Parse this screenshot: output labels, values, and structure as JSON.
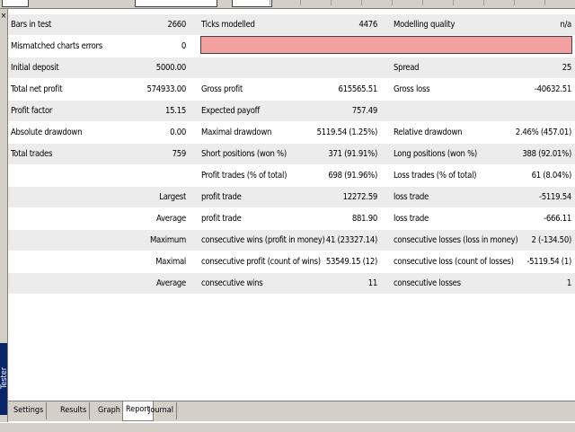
{
  "window": {
    "panel_label": "Tester"
  },
  "report": {
    "rows": [
      {
        "style": "gray",
        "c1": "Bars in test",
        "c2": "2660",
        "c3": "Ticks modelled",
        "c4": "4476",
        "c5": "Modelling quality",
        "c6": "n/a"
      },
      {
        "style": "white",
        "c1": "Mismatched charts errors",
        "c2": "0",
        "c3": "",
        "c4": "",
        "c5": "",
        "c6": ""
      },
      {
        "style": "gray",
        "c1": "Initial deposit",
        "c2": "5000.00",
        "c3": "",
        "c4": "",
        "c5": "Spread",
        "c6": "25"
      },
      {
        "style": "white",
        "c1": "Total net profit",
        "c2": "574933.00",
        "c3": "Gross profit",
        "c4": "615565.51",
        "c5": "Gross loss",
        "c6": "-40632.51"
      },
      {
        "style": "gray",
        "c1": "Profit factor",
        "c2": "15.15",
        "c3": "Expected payoff",
        "c4": "757.49",
        "c5": "",
        "c6": ""
      },
      {
        "style": "white",
        "c1": "Absolute drawdown",
        "c2": "0.00",
        "c3": "Maximal drawdown",
        "c4": "5119.54 (1.25%)",
        "c5": "Relative drawdown",
        "c6": "2.46% (457.01)"
      },
      {
        "style": "gray",
        "c1": "Total trades",
        "c2": "759",
        "c3": "Short positions (won %)",
        "c4": "371 (91.91%)",
        "c5": "Long positions (won %)",
        "c6": "388 (92.01%)"
      },
      {
        "style": "white",
        "c1": "",
        "c2": "",
        "c3": "Profit trades (% of total)",
        "c4": "698 (91.96%)",
        "c5": "Loss trades (% of total)",
        "c6": "61 (8.04%)"
      },
      {
        "style": "gray",
        "c1": "",
        "c2": "Largest",
        "c3": "profit trade",
        "c4": "12272.59",
        "c5": "loss trade",
        "c6": "-5119.54"
      },
      {
        "style": "white",
        "c1": "",
        "c2": "Average",
        "c3": "profit trade",
        "c4": "881.90",
        "c5": "loss trade",
        "c6": "-666.11"
      },
      {
        "style": "gray",
        "c1": "",
        "c2": "Maximum",
        "c3": "consecutive wins (profit in money)",
        "c4": "41 (23327.14)",
        "c5": "consecutive losses (loss in money)",
        "c6": "2 (-134.50)"
      },
      {
        "style": "white",
        "c1": "",
        "c2": "Maximal",
        "c3": "consecutive profit (count of wins)",
        "c4": "53549.15 (12)",
        "c5": "consecutive loss (count of losses)",
        "c6": "-5119.54 (1)"
      },
      {
        "style": "gray",
        "c1": "",
        "c2": "Average",
        "c3": "consecutive wins",
        "c4": "11",
        "c5": "consecutive losses",
        "c6": "1"
      }
    ]
  },
  "tabs": [
    {
      "label": "Settings",
      "active": false
    },
    {
      "label": "Results",
      "active": false
    },
    {
      "label": "Graph",
      "active": false
    },
    {
      "label": "Report",
      "active": true
    },
    {
      "label": "Journal",
      "active": false
    }
  ]
}
